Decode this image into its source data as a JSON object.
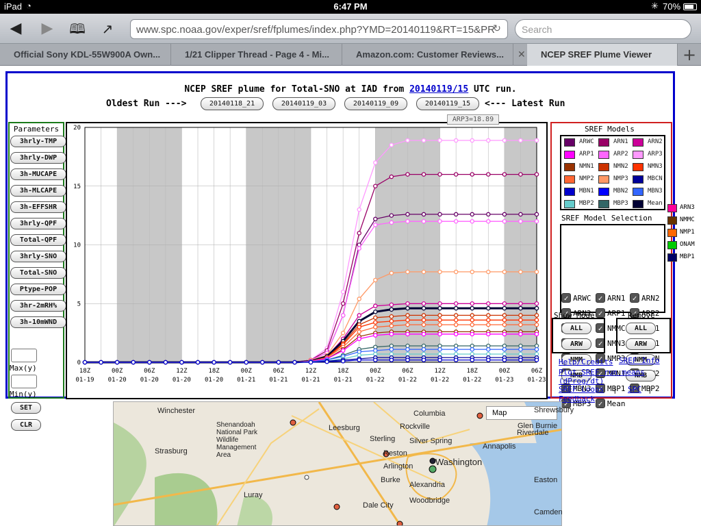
{
  "status": {
    "device": "iPad",
    "time": "6:47 PM",
    "battery": "70%"
  },
  "browser": {
    "url": "www.spc.noaa.gov/exper/sref/fplumes/index.php?YMD=20140119&RT=15&PR",
    "search_placeholder": "Search",
    "tabs": [
      {
        "label": "Official Sony KDL-55W900A Own..."
      },
      {
        "label": "1/21 Clipper Thread - Page 4 - Mi..."
      },
      {
        "label": "Amazon.com: Customer Reviews..."
      },
      {
        "label": "NCEP SREF Plume Viewer"
      }
    ]
  },
  "page": {
    "title_prefix": "NCEP SREF plume for Total-SNO at IAD from ",
    "title_link": "20140119/15",
    "title_suffix": " UTC run.",
    "oldest": "Oldest Run --->",
    "latest": "<--- Latest Run",
    "runs": [
      "20140118_21",
      "20140119_03",
      "20140119_09",
      "20140119_15"
    ],
    "tooltip": "ARP3=18.89",
    "params_title": "Parameters",
    "params": [
      "3hrly-TMP",
      "3hrly-DWP",
      "3h-MUCAPE",
      "3h-MLCAPE",
      "3h-EFFSHR",
      "3hrly-QPF",
      "Total-QPF",
      "3hrly-SNO",
      "Total-SNO",
      "Ptype-POP",
      "3hr-2mRH%",
      "3h-10mWND"
    ],
    "max_label": "Max(y)",
    "min_label": "Min(y)",
    "set": "SET",
    "clr": "CLR",
    "models_title": "SREF Models",
    "legend": [
      {
        "name": "ARWC",
        "color": "#660066"
      },
      {
        "name": "ARN1",
        "color": "#990066"
      },
      {
        "name": "ARN2",
        "color": "#cc0099"
      },
      {
        "name": "ARP1",
        "color": "#ff00ff"
      },
      {
        "name": "ARP2",
        "color": "#ff66ff"
      },
      {
        "name": "ARP3",
        "color": "#ff99ff"
      },
      {
        "name": "NMN1",
        "color": "#993300"
      },
      {
        "name": "NMN2",
        "color": "#cc3300"
      },
      {
        "name": "NMN3",
        "color": "#ff3300"
      },
      {
        "name": "NMP2",
        "color": "#ff6633"
      },
      {
        "name": "NMP3",
        "color": "#ff9966"
      },
      {
        "name": "MBCN",
        "color": "#000099"
      },
      {
        "name": "MBN1",
        "color": "#0000cc"
      },
      {
        "name": "MBN2",
        "color": "#0000ff"
      },
      {
        "name": "MBN3",
        "color": "#3366ff"
      },
      {
        "name": "MBP2",
        "color": "#66cccc"
      },
      {
        "name": "MBP3",
        "color": "#336666"
      },
      {
        "name": "Mean",
        "color": "#000033"
      }
    ],
    "legend_ext": [
      {
        "name": "ARN3",
        "color": "#ff0099"
      },
      {
        "name": "NMMC",
        "color": "#663300"
      },
      {
        "name": "NMP1",
        "color": "#ff6600"
      },
      {
        "name": "ONAM",
        "color": "#00cc00"
      },
      {
        "name": "MBP1",
        "color": "#000066"
      }
    ],
    "selection_title": "SREF Model Selection",
    "selection": [
      "ARWC",
      "ARN1",
      "ARN2",
      "ARN3",
      "ARP1",
      "ARP2",
      "ARP3",
      "NMMC",
      "NMN1",
      "NMN2",
      "NMN3",
      "NMP1",
      "NMP2",
      "NMP3",
      "MBCN",
      "ONAM",
      "MBN1",
      "MBN2",
      "MBN3",
      "MBP1",
      "MBP2",
      "MBP3",
      "Mean"
    ],
    "show_mode": "Show Mode",
    "remove": "Remove",
    "btn_all": "ALL",
    "btn_arw": "ARW",
    "btn_nmm": "NMM",
    "btn_nmb": "NMB",
    "help": "Help/Credits",
    "sref_info": "SREF Info",
    "plot_means": "Plot SREF run means (dProg/dt)",
    "loops": "SREF Loops",
    "spc": "SPC",
    "feedback": "Feedback",
    "map_type": "Map",
    "cities": [
      "Winchester",
      "Columbia",
      "Glen Burnie",
      "Shrewsbury",
      "Riverdale",
      "Leesburg",
      "Rockville",
      "Shenandoah National Park Wildlife Management Area",
      "Sterling",
      "Silver Spring",
      "Annapolis",
      "Strasburg",
      "Reston",
      "Arlington",
      "Washington",
      "Alexandria",
      "Burke",
      "Luray",
      "Dale City",
      "Woodbridge",
      "Camden",
      "Easton"
    ]
  },
  "chart_data": {
    "type": "line",
    "title": "NCEP SREF plume for Total-SNO at IAD from 20140119/15 UTC run.",
    "x": [
      "18Z 01-19",
      "00Z 01-20",
      "06Z 01-20",
      "12Z 01-20",
      "18Z 01-20",
      "00Z 01-21",
      "06Z 01-21",
      "12Z 01-21",
      "18Z 01-21",
      "00Z 01-22",
      "06Z 01-22",
      "12Z 01-22",
      "18Z 01-22",
      "00Z 01-23",
      "06Z 01-23"
    ],
    "x_tick_times": [
      "18Z",
      "00Z",
      "06Z",
      "12Z",
      "18Z",
      "00Z",
      "06Z",
      "12Z",
      "18Z",
      "00Z",
      "06Z",
      "12Z",
      "18Z",
      "00Z",
      "06Z"
    ],
    "x_tick_dates": [
      "01-19",
      "01-20",
      "01-20",
      "01-20",
      "01-20",
      "01-21",
      "01-21",
      "01-21",
      "01-21",
      "01-22",
      "01-22",
      "01-22",
      "01-22",
      "01-23",
      "01-23"
    ],
    "yticks": [
      0,
      5,
      10,
      15,
      20
    ],
    "ylim": [
      0,
      20
    ],
    "grid": true,
    "shaded_night": [
      [
        1,
        3
      ],
      [
        5,
        7
      ],
      [
        9,
        11
      ],
      [
        13,
        14
      ]
    ],
    "series": [
      {
        "name": "ARP3",
        "color": "#ff99ff",
        "final": 18.89,
        "rise": [
          0.2,
          1.2,
          6,
          13,
          17,
          18.5,
          18.89
        ]
      },
      {
        "name": "ARN1",
        "color": "#990066",
        "final": 16.0,
        "rise": [
          0.2,
          1,
          5,
          11,
          15,
          15.8,
          16.0
        ]
      },
      {
        "name": "ARWC",
        "color": "#660066",
        "final": 12.6,
        "rise": [
          0.2,
          0.8,
          4,
          10,
          12.2,
          12.5,
          12.6
        ]
      },
      {
        "name": "ARP2",
        "color": "#ff66ff",
        "final": 12.0,
        "rise": [
          0.2,
          0.8,
          4,
          9.7,
          11.7,
          11.9,
          12.0
        ]
      },
      {
        "name": "NMP3",
        "color": "#ff9966",
        "final": 7.7,
        "rise": [
          0.2,
          0.6,
          2.5,
          5.4,
          7.0,
          7.6,
          7.7
        ]
      },
      {
        "name": "ARN2",
        "color": "#cc0099",
        "final": 5.0,
        "rise": [
          0.1,
          0.5,
          2.0,
          4.0,
          4.8,
          4.9,
          5.0
        ]
      },
      {
        "name": "Mean",
        "color": "#000033",
        "final": 4.6,
        "rise": [
          0.1,
          0.5,
          1.8,
          3.5,
          4.3,
          4.5,
          4.6
        ]
      },
      {
        "name": "NMN2",
        "color": "#cc3300",
        "final": 4.0,
        "rise": [
          0.1,
          0.4,
          1.6,
          3.2,
          3.8,
          3.9,
          4.0
        ]
      },
      {
        "name": "NMN3",
        "color": "#ff3300",
        "final": 3.6,
        "rise": [
          0.1,
          0.4,
          1.5,
          3.0,
          3.4,
          3.5,
          3.6
        ]
      },
      {
        "name": "NMP2",
        "color": "#ff6633",
        "final": 3.2,
        "rise": [
          0.1,
          0.4,
          1.3,
          2.6,
          3.0,
          3.1,
          3.2
        ]
      },
      {
        "name": "NMN1",
        "color": "#993300",
        "final": 2.6,
        "rise": [
          0.1,
          0.3,
          1.1,
          2.2,
          2.5,
          2.6,
          2.6
        ]
      },
      {
        "name": "ARP1",
        "color": "#ff00ff",
        "final": 2.4,
        "rise": [
          0.1,
          0.3,
          1.0,
          2.0,
          2.3,
          2.4,
          2.4
        ]
      },
      {
        "name": "MBP3",
        "color": "#336666",
        "final": 1.4,
        "rise": [
          0.05,
          0.2,
          0.6,
          1.1,
          1.3,
          1.4,
          1.4
        ]
      },
      {
        "name": "MBN3",
        "color": "#3366ff",
        "final": 1.1,
        "rise": [
          0.05,
          0.2,
          0.5,
          0.9,
          1.0,
          1.1,
          1.1
        ]
      },
      {
        "name": "MBP2",
        "color": "#66cccc",
        "final": 0.7,
        "rise": [
          0.05,
          0.1,
          0.3,
          0.6,
          0.7,
          0.7,
          0.7
        ]
      },
      {
        "name": "MBCN",
        "color": "#000099",
        "final": 0.4,
        "rise": [
          0.02,
          0.1,
          0.2,
          0.3,
          0.4,
          0.4,
          0.4
        ]
      },
      {
        "name": "MBN1",
        "color": "#0000cc",
        "final": 0.2,
        "rise": [
          0.0,
          0.05,
          0.1,
          0.2,
          0.2,
          0.2,
          0.2
        ]
      }
    ]
  }
}
